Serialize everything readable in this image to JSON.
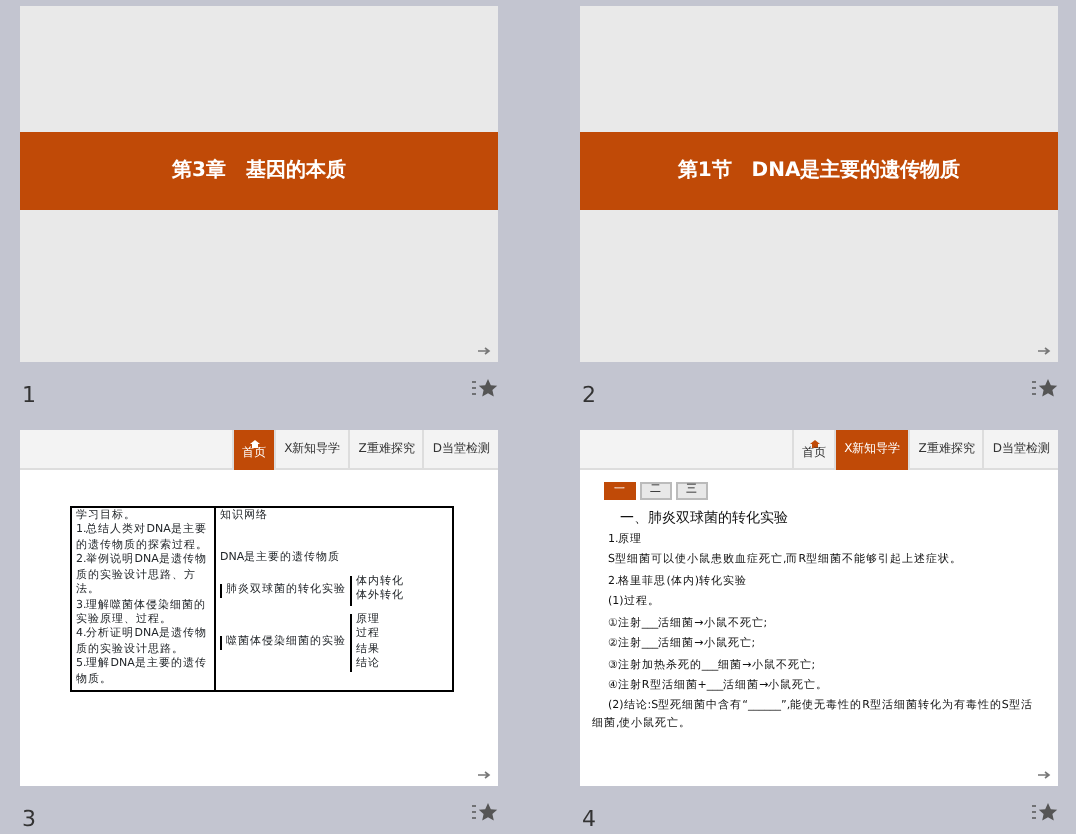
{
  "slides": [
    {
      "number": "1",
      "kind": "title",
      "title": "第3章　基因的本质"
    },
    {
      "number": "2",
      "kind": "title",
      "title": "第1节　DNA是主要的遗传物质"
    },
    {
      "number": "3",
      "kind": "objectives",
      "nav": [
        {
          "label": "首页",
          "kind": "home",
          "selected": true
        },
        {
          "label": "X新知导学",
          "kind": "text",
          "selected": false
        },
        {
          "label": "Z重难探究",
          "kind": "text",
          "selected": false
        },
        {
          "label": "D当堂检测",
          "kind": "text",
          "selected": false
        }
      ],
      "objectives": [
        "学习目标。",
        "1.总结人类对DNA是主要的遗传物质的探索过程。",
        "2.举例说明DNA是遗传物质的实验设计思路、方法。",
        "3.理解噬菌体侵染细菌的实验原理、过程。",
        "4.分析证明DNA是遗传物质的实验设计思路。",
        "5.理解DNA是主要的遗传物质。"
      ],
      "map": {
        "heading": "知识网络",
        "root": "DNA是主要的遗传物质",
        "branches": [
          {
            "label": "肺炎双球菌的转化实验",
            "leaves": [
              "体内转化",
              "体外转化"
            ]
          },
          {
            "label": "噬菌体侵染细菌的实验",
            "leaves": [
              "原理",
              "过程",
              "结果",
              "结论"
            ]
          }
        ]
      }
    },
    {
      "number": "4",
      "kind": "text",
      "nav": [
        {
          "label": "首页",
          "kind": "home",
          "selected": false
        },
        {
          "label": "X新知导学",
          "kind": "text",
          "selected": true
        },
        {
          "label": "Z重难探究",
          "kind": "text",
          "selected": false
        },
        {
          "label": "D当堂检测",
          "kind": "text",
          "selected": false
        }
      ],
      "subtabs": [
        {
          "label": "一",
          "selected": true
        },
        {
          "label": "二",
          "selected": false
        },
        {
          "label": "三",
          "selected": false
        }
      ],
      "lines": [
        {
          "text": "一、肺炎双球菌的转化实验",
          "kind": "heading"
        },
        {
          "text": "1.原理",
          "kind": "line"
        },
        {
          "text": "S型细菌可以使小鼠患败血症死亡,而R型细菌不能够引起上述症状。",
          "kind": "line"
        },
        {
          "text": "2.格里菲思(体内)转化实验",
          "kind": "line"
        },
        {
          "text": "(1)过程。",
          "kind": "line"
        },
        {
          "text": "①注射___活细菌→小鼠不死亡;",
          "kind": "line"
        },
        {
          "text": "②注射___活细菌→小鼠死亡;",
          "kind": "line"
        },
        {
          "text": "③注射加热杀死的___细菌→小鼠不死亡;",
          "kind": "line"
        },
        {
          "text": "④注射R型活细菌+___活细菌→小鼠死亡。",
          "kind": "line"
        },
        {
          "text": "(2)结论:S型死细菌中含有“______”,能使无毒性的R型活细菌转化为有毒性的S型活细菌,使小鼠死亡。",
          "kind": "para"
        }
      ]
    }
  ]
}
